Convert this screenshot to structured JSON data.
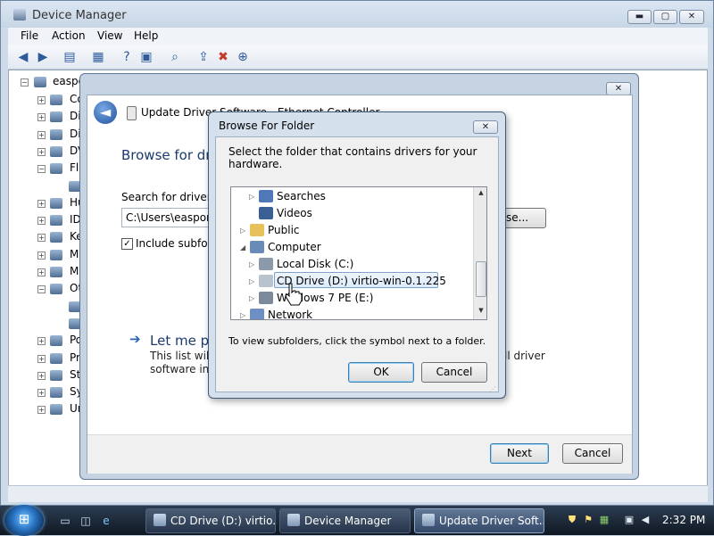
{
  "device_manager": {
    "title": "Device Manager",
    "window_buttons": {
      "minimize": "▬",
      "maximize": "▢",
      "close": "✕"
    },
    "menu": [
      "File",
      "Action",
      "View",
      "Help"
    ],
    "tree": {
      "root": "easpo",
      "items": [
        "Co",
        "Di",
        "Di",
        "DV",
        "Fl",
        "",
        "Hu",
        "ID",
        "Ke",
        "Mi",
        "Mo",
        "Ot",
        "",
        "",
        "Po",
        "Pr",
        "St",
        "Sy",
        "Un"
      ]
    }
  },
  "update_driver": {
    "title": "Update Driver Software - Ethernet Controller",
    "back_glyph": "◄",
    "close_glyph": "✕",
    "heading": "Browse for dri",
    "search_label": "Search for driver so",
    "path_value": "C:\\Users\\easports",
    "browse_label": "se...",
    "include_label": "Include subfold",
    "include_checked": true,
    "let_me": {
      "arrow": "➔",
      "title": "Let me pi",
      "desc_line1": "This list will s",
      "desc_line2": "software in t",
      "desc_right1": "ll driver"
    },
    "next_label": "Next",
    "cancel_label": "Cancel"
  },
  "browse_folder": {
    "title": "Browse For Folder",
    "close_glyph": "✕",
    "instruction": "Select the folder that contains drivers for your hardware.",
    "tree": [
      {
        "label": "Searches",
        "expander": "▷",
        "level": 2
      },
      {
        "label": "Videos",
        "expander": "",
        "level": 2
      },
      {
        "label": "Public",
        "expander": "▷",
        "level": 1
      },
      {
        "label": "Computer",
        "expander": "◢",
        "level": 1
      },
      {
        "label": "Local Disk (C:)",
        "expander": "▷",
        "level": 2
      },
      {
        "label": "CD Drive (D:) virtio-win-0.1.225",
        "expander": "▷",
        "level": 2,
        "selected": true
      },
      {
        "label": "Windows 7 PE (E:)",
        "expander": "▷",
        "level": 2
      },
      {
        "label": "Network",
        "expander": "▷",
        "level": 1
      }
    ],
    "hint": "To view subfolders, click the symbol next to a folder.",
    "ok_label": "OK",
    "cancel_label": "Cancel"
  },
  "taskbar": {
    "start_glyph": "⊞",
    "tasks": [
      {
        "label": "CD Drive (D:) virtio..."
      },
      {
        "label": "Device Manager"
      },
      {
        "label": "Update Driver Soft..."
      }
    ],
    "clock": "2:32 PM"
  },
  "colors": {
    "accent": "#1c3a6e",
    "window_frame": "#cfdbe8",
    "taskbar": "#1a2533",
    "selection": "#dcebfc"
  }
}
